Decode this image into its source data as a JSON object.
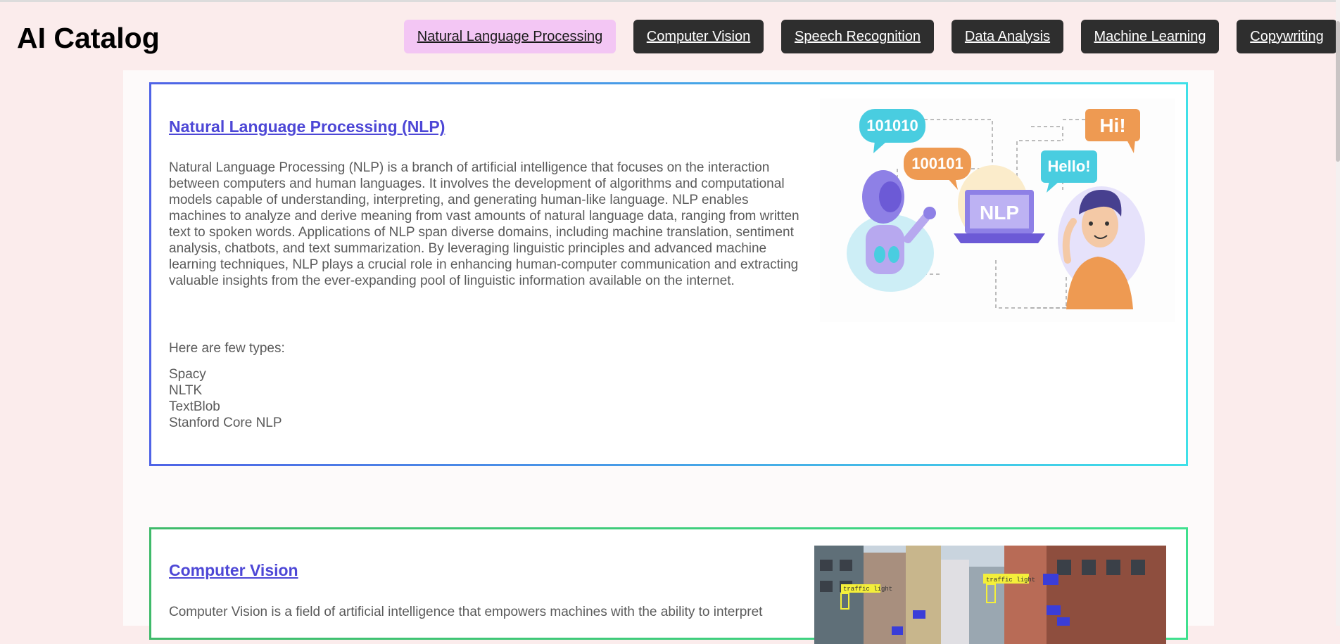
{
  "header": {
    "brand": "AI Catalog",
    "nav": [
      {
        "label": "Natural Language Processing",
        "active": true
      },
      {
        "label": "Computer Vision",
        "active": false
      },
      {
        "label": "Speech Recognition",
        "active": false
      },
      {
        "label": "Data Analysis",
        "active": false
      },
      {
        "label": "Machine Learning",
        "active": false
      },
      {
        "label": "Copywriting",
        "active": false
      }
    ]
  },
  "sections": [
    {
      "title": "Natural Language Processing (NLP)",
      "description": "Natural Language Processing (NLP) is a branch of artificial intelligence that focuses on the interaction between computers and human languages. It involves the development of algorithms and computational models capable of understanding, interpreting, and generating human-like language. NLP enables machines to analyze and derive meaning from vast amounts of natural language data, ranging from written text to spoken words. Applications of NLP span diverse domains, including machine translation, sentiment analysis, chatbots, and text summarization. By leveraging linguistic principles and advanced machine learning techniques, NLP plays a crucial role in enhancing human-computer communication and extracting valuable insights from the ever-expanding pool of linguistic information available on the internet.",
      "types_intro": "Here are few types:",
      "types": [
        "Spacy",
        "NLTK",
        "TextBlob",
        "Stanford Core NLP"
      ],
      "illustration": {
        "bubbles": [
          "101010",
          "100101",
          "Hello!",
          "Hi!"
        ],
        "laptop_text": "NLP"
      }
    },
    {
      "title": "Computer Vision",
      "description": "Computer Vision is a field of artificial intelligence that empowers machines with the ability to interpret",
      "photo": {
        "tags": [
          "traffic light",
          "traffic light"
        ]
      }
    }
  ],
  "colors": {
    "page_bg": "#fbecec",
    "nav_bg": "#2e2e2e",
    "nav_active_bg": "#f3c6f4",
    "link": "#4d47d6",
    "nlp_border_start": "#4f63e6",
    "nlp_border_end": "#3fe0e8",
    "cv_border_start": "#3fba6a",
    "cv_border_end": "#3fe08e"
  }
}
